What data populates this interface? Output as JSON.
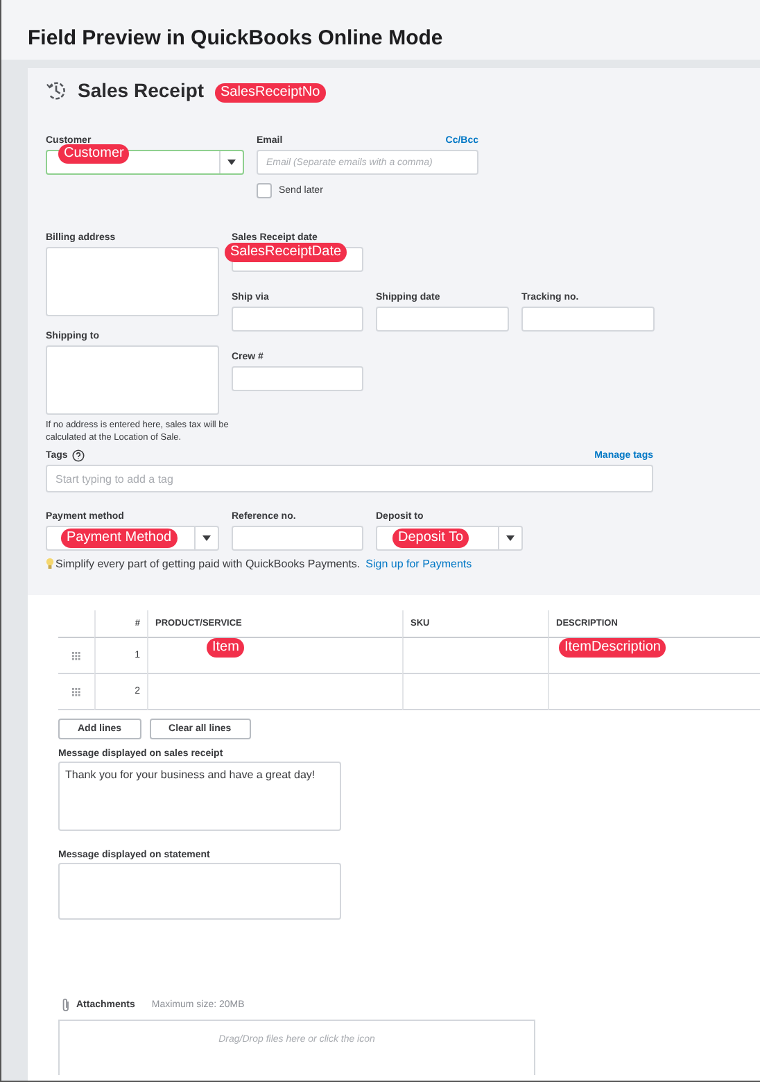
{
  "title": "Field Preview in QuickBooks Online Mode",
  "header": {
    "heading": "Sales Receipt",
    "badge": "SalesReceiptNo"
  },
  "customer": {
    "label": "Customer",
    "badge": "Customer"
  },
  "email": {
    "label": "Email",
    "link": "Cc/Bcc",
    "placeholder": "Email (Separate emails with a comma)"
  },
  "send_later": {
    "label": "Send later",
    "checked": false
  },
  "billing_address": {
    "label": "Billing address"
  },
  "sales_receipt_date": {
    "label": "Sales Receipt date",
    "badge": "SalesReceiptDate"
  },
  "shipping": [
    {
      "label": "Ship via"
    },
    {
      "label": "Shipping date"
    },
    {
      "label": "Tracking no."
    }
  ],
  "shipping_to": {
    "label": "Shipping to",
    "note": "If no address is entered here, sales tax will be calculated at the Location of Sale."
  },
  "crew": {
    "label": "Crew #"
  },
  "tags": {
    "label": "Tags",
    "link": "Manage tags",
    "placeholder": "Start typing to add a tag"
  },
  "payment": [
    {
      "label": "Payment method",
      "kind": "dropdown",
      "badge": "Payment Method"
    },
    {
      "label": "Reference no.",
      "kind": "text"
    },
    {
      "label": "Deposit to",
      "kind": "dropdown",
      "badge": "Deposit To"
    }
  ],
  "tip": {
    "text": "Simplify every part of getting paid with QuickBooks Payments.",
    "link": "Sign up for Payments"
  },
  "table": {
    "columns": [
      "#",
      "PRODUCT/SERVICE",
      "SKU",
      "DESCRIPTION"
    ],
    "rows": [
      {
        "number": "1",
        "product_badge": "Item",
        "description_badge": "ItemDescription"
      },
      {
        "number": "2"
      }
    ]
  },
  "table_buttons": [
    "Add lines",
    "Clear all lines"
  ],
  "messages": [
    {
      "label": "Message displayed on sales receipt",
      "value": "Thank you for your business and have a great day!"
    },
    {
      "label": "Message displayed on statement"
    }
  ],
  "attachments": {
    "label": "Attachments",
    "max_size": "Maximum size: 20MB",
    "dropzone": "Drag/Drop files here or click the icon"
  }
}
